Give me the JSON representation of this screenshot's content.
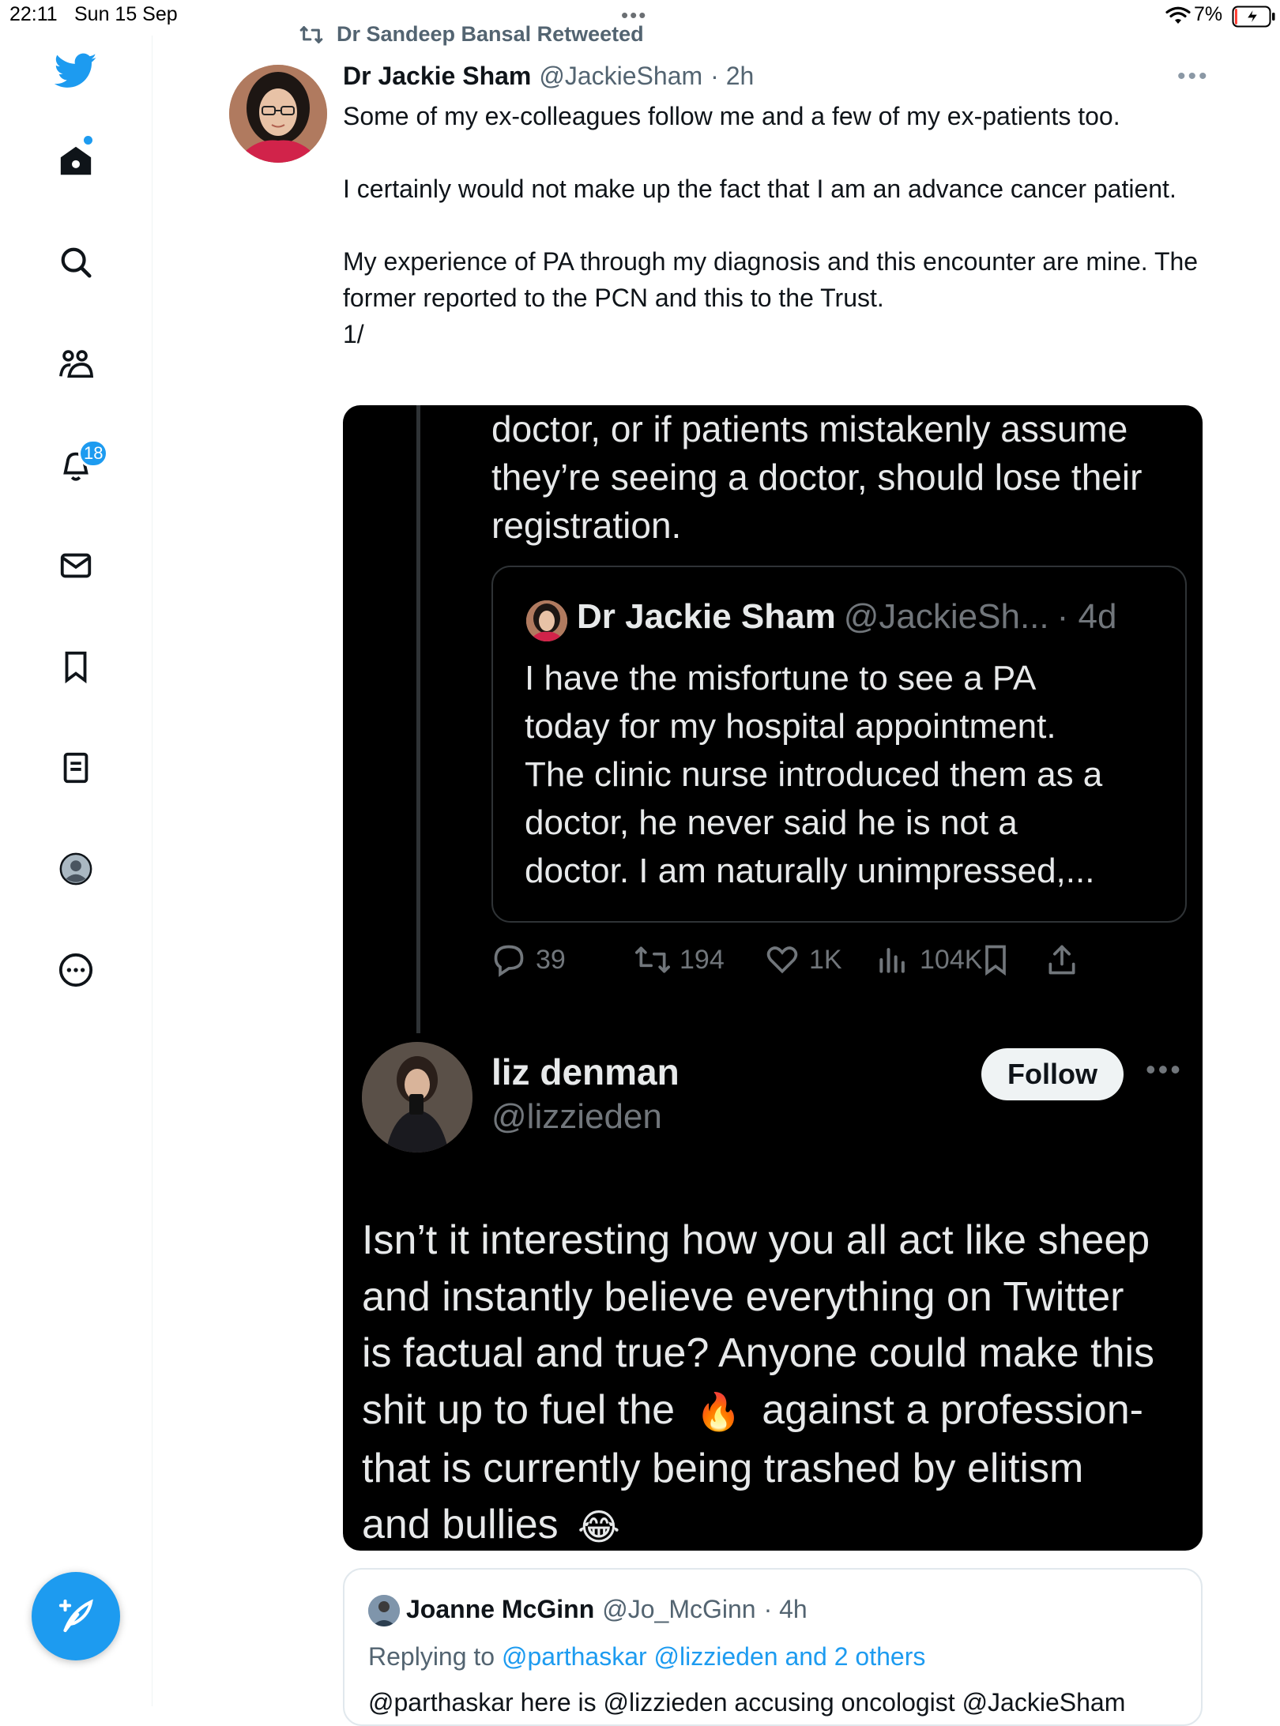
{
  "status_bar": {
    "time": "22:11",
    "date": "Sun 15 Sep",
    "dots": "•••",
    "battery_percent": "7%",
    "battery_level": 0.07
  },
  "sidebar": {
    "items": [
      {
        "icon": "twitter-logo-icon"
      },
      {
        "icon": "home-icon"
      },
      {
        "icon": "search-icon"
      },
      {
        "icon": "communities-icon"
      },
      {
        "icon": "notifications-icon",
        "badge": "18"
      },
      {
        "icon": "messages-icon"
      },
      {
        "icon": "bookmarks-icon"
      },
      {
        "icon": "lists-icon"
      },
      {
        "icon": "profile-icon"
      },
      {
        "icon": "more-icon"
      }
    ],
    "compose_icon": "compose-feather-icon"
  },
  "tweet": {
    "retweeted_by": "Dr Sandeep Bansal Retweeted",
    "author_name": "Dr Jackie Sham",
    "author_handle": "@JackieSham",
    "time": "· 2h",
    "more": "•••",
    "paragraphs": [
      "Some of my ex-colleagues follow me and a few of my ex-patients too.",
      "I certainly would not make up the fact that I am an advance cancer patient.",
      "My experience of PA through my diagnosis and this encounter are mine. The former reported to the PCN and this to the Trust.",
      "1/"
    ]
  },
  "media": {
    "top_text_lines": [
      "doctor, or if patients mistakenly assume",
      "they’re seeing a doctor, should lose their",
      "registration."
    ],
    "quote": {
      "name": "Dr Jackie Sham",
      "handle": "@JackieSh...",
      "time": "· 4d",
      "text_lines": [
        "I have the misfortune to see a PA",
        "today for my hospital appointment.",
        "The clinic nurse introduced them as a",
        "doctor, he never said he is not a",
        "doctor. I am naturally unimpressed,..."
      ]
    },
    "actions": {
      "replies": "39",
      "retweets": "194",
      "likes": "1K",
      "views": "104K"
    },
    "reply": {
      "name": "liz denman",
      "handle": "@lizzieden",
      "follow_label": "Follow",
      "more": "•••",
      "line1": "Isn’t it interesting how you all act like sheep",
      "line2": "and instantly believe everything on Twitter",
      "line3": "is factual and true? Anyone could make this",
      "line4a": "shit up to fuel the",
      "line4b": "against a profession-",
      "line5": "that is currently being trashed by elitism",
      "line6": "and bullies",
      "emoji_fire": "🔥",
      "emoji_laugh": "😂"
    }
  },
  "bottom_tweet": {
    "name": "Joanne McGinn",
    "handle": "@Jo_McGinn",
    "time": "· 4h",
    "replying_prefix": "Replying to",
    "replying_links": "@parthaskar @lizzieden and 2 others",
    "text": "@parthaskar here is @lizzieden accusing oncologist @JackieSham"
  },
  "colors": {
    "accent": "#1d9bf0",
    "text": "#0f1419",
    "secondary": "#536471",
    "media_bg": "#000000"
  }
}
